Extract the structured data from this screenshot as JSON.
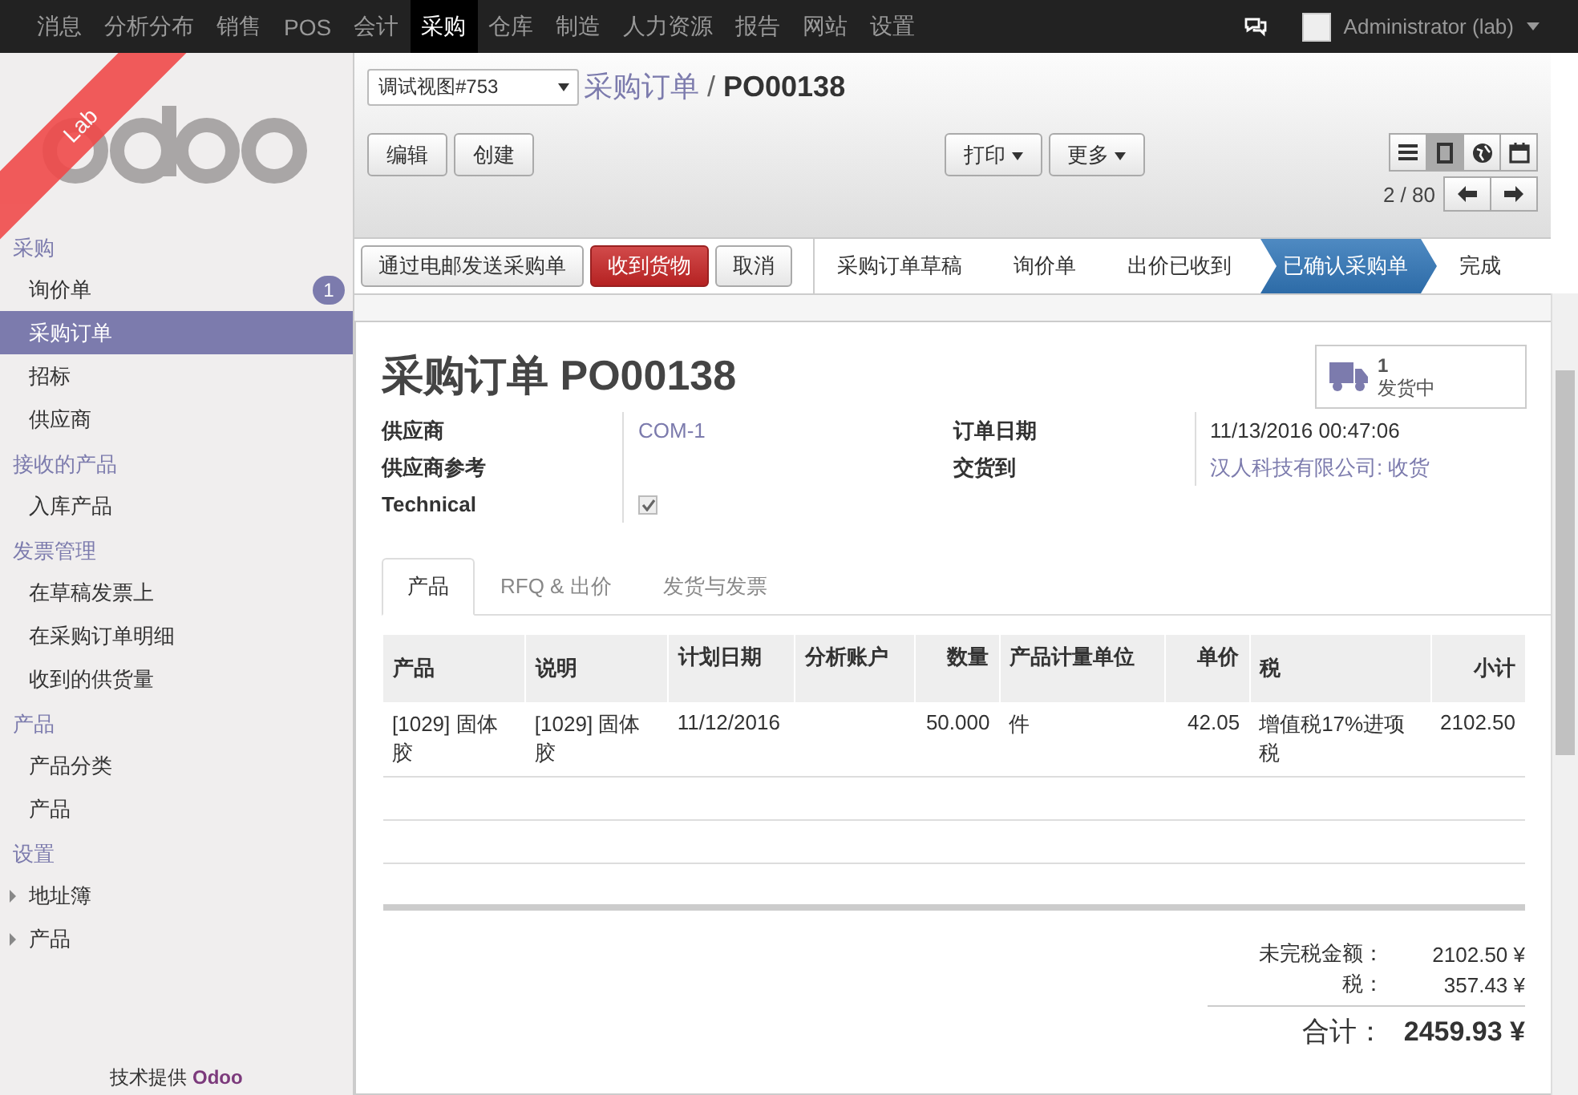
{
  "top_menu": [
    {
      "label": "消息",
      "selected": false
    },
    {
      "label": "分析分布",
      "selected": false
    },
    {
      "label": "销售",
      "selected": false
    },
    {
      "label": "POS",
      "selected": false
    },
    {
      "label": "会计",
      "selected": false
    },
    {
      "label": "采购",
      "selected": true
    },
    {
      "label": "仓库",
      "selected": false
    },
    {
      "label": "制造",
      "selected": false
    },
    {
      "label": "人力资源",
      "selected": false
    },
    {
      "label": "报告",
      "selected": false
    },
    {
      "label": "网站",
      "selected": false
    },
    {
      "label": "设置",
      "selected": false
    }
  ],
  "user": {
    "name": "Administrator (lab)"
  },
  "sidebar": {
    "ribbon": "Lab",
    "sections": [
      {
        "title": "采购",
        "items": [
          {
            "label": "询价单",
            "badge": "1",
            "selected": false,
            "expandable": false
          },
          {
            "label": "采购订单",
            "selected": true,
            "expandable": false
          },
          {
            "label": "招标",
            "selected": false,
            "expandable": false
          },
          {
            "label": "供应商",
            "selected": false,
            "expandable": false
          }
        ]
      },
      {
        "title": "接收的产品",
        "items": [
          {
            "label": "入库产品",
            "selected": false,
            "expandable": false
          }
        ]
      },
      {
        "title": "发票管理",
        "items": [
          {
            "label": "在草稿发票上",
            "selected": false,
            "expandable": false
          },
          {
            "label": "在采购订单明细",
            "selected": false,
            "expandable": false
          },
          {
            "label": "收到的供货量",
            "selected": false,
            "expandable": false
          }
        ]
      },
      {
        "title": "产品",
        "items": [
          {
            "label": "产品分类",
            "selected": false,
            "expandable": false
          },
          {
            "label": "产品",
            "selected": false,
            "expandable": false
          }
        ]
      },
      {
        "title": "设置",
        "items": [
          {
            "label": "地址簿",
            "selected": false,
            "expandable": true
          },
          {
            "label": "产品",
            "selected": false,
            "expandable": true
          }
        ]
      }
    ],
    "footer": {
      "text": "技术提供",
      "brand": "Odoo"
    }
  },
  "view_select": {
    "value": "调试视图#753"
  },
  "breadcrumb": {
    "parent": "采购订单",
    "separator": "/",
    "current": "PO00138"
  },
  "buttons": [
    "编辑",
    "创建"
  ],
  "dropdowns": [
    "打印",
    "更多"
  ],
  "view_modes": [
    {
      "kind": "list",
      "selected": false
    },
    {
      "kind": "form",
      "selected": true
    },
    {
      "kind": "map",
      "selected": false
    },
    {
      "kind": "calendar",
      "selected": false
    }
  ],
  "pager": "2 / 80",
  "actions": [
    {
      "label": "通过电邮发送采购单",
      "kind": "default"
    },
    {
      "label": "收到货物",
      "kind": "primary"
    },
    {
      "label": "取消",
      "kind": "default"
    }
  ],
  "stages": [
    {
      "label": "采购订单草稿",
      "selected": false
    },
    {
      "label": "询价单",
      "selected": false
    },
    {
      "label": "出价已收到",
      "selected": false
    },
    {
      "label": "已确认采购单",
      "selected": true
    },
    {
      "label": "完成",
      "selected": false
    }
  ],
  "form": {
    "title": "采购订单 PO00138",
    "smart_button": {
      "count": "1",
      "label": "发货中"
    },
    "left_fields": [
      {
        "label": "供应商",
        "kind": "link",
        "value": "COM-1"
      },
      {
        "label": "供应商参考",
        "kind": "text"
      },
      {
        "label": "Technical",
        "kind": "checkbox",
        "checked": true
      }
    ],
    "right_fields": [
      {
        "label": "订单日期",
        "kind": "text",
        "value": "11/13/2016 00:47:06"
      },
      {
        "label": "交货到",
        "kind": "link",
        "value": "汉人科技有限公司: 收货"
      }
    ],
    "tabs": [
      {
        "label": "产品",
        "selected": true
      },
      {
        "label": "RFQ & 出价",
        "selected": false
      },
      {
        "label": "发货与发票",
        "selected": false
      }
    ],
    "table": {
      "columns": [
        {
          "label": "产品",
          "numeric": false
        },
        {
          "label": "说明",
          "numeric": false
        },
        {
          "label": "计划日期",
          "numeric": false
        },
        {
          "label": "分析账户",
          "numeric": false
        },
        {
          "label": "数量",
          "numeric": true
        },
        {
          "label": "产品计量单位",
          "numeric": false
        },
        {
          "label": "单价",
          "numeric": true
        },
        {
          "label": "税",
          "numeric": false
        },
        {
          "label": "小计",
          "numeric": true
        }
      ],
      "rows": [
        [
          "[1029] 固体胶",
          "[1029] 固体胶",
          "11/12/2016",
          null,
          "50.000",
          "件",
          "42.05",
          "增值税17%进项税",
          "2102.50"
        ]
      ]
    },
    "totals": [
      {
        "label": "未完税金额：",
        "value": "2102.50 ¥",
        "kind": "sub"
      },
      {
        "label": "税：",
        "value": "357.43 ¥",
        "kind": "sub"
      },
      {
        "label": "合计：",
        "value": "2459.93 ¥",
        "kind": "total"
      }
    ]
  }
}
